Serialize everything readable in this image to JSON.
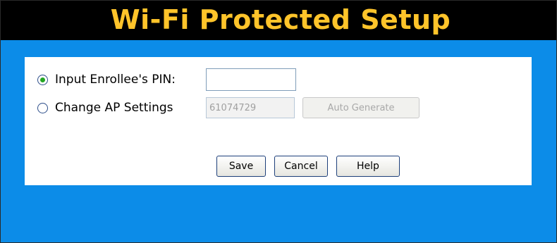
{
  "header": {
    "title": "Wi-Fi Protected Setup"
  },
  "form": {
    "options": [
      {
        "label": "Input Enrollee's PIN:",
        "selected": true,
        "value": "",
        "placeholder": ""
      },
      {
        "label": "Change AP Settings",
        "selected": false,
        "value": "61074729",
        "disabled": true
      }
    ],
    "auto_generate_label": "Auto Generate"
  },
  "actions": {
    "save_label": "Save",
    "cancel_label": "Cancel",
    "help_label": "Help"
  },
  "colors": {
    "background": "#0c8ce8",
    "title_bar": "#000000",
    "title_text": "#ffc42a",
    "panel": "#ffffff"
  }
}
